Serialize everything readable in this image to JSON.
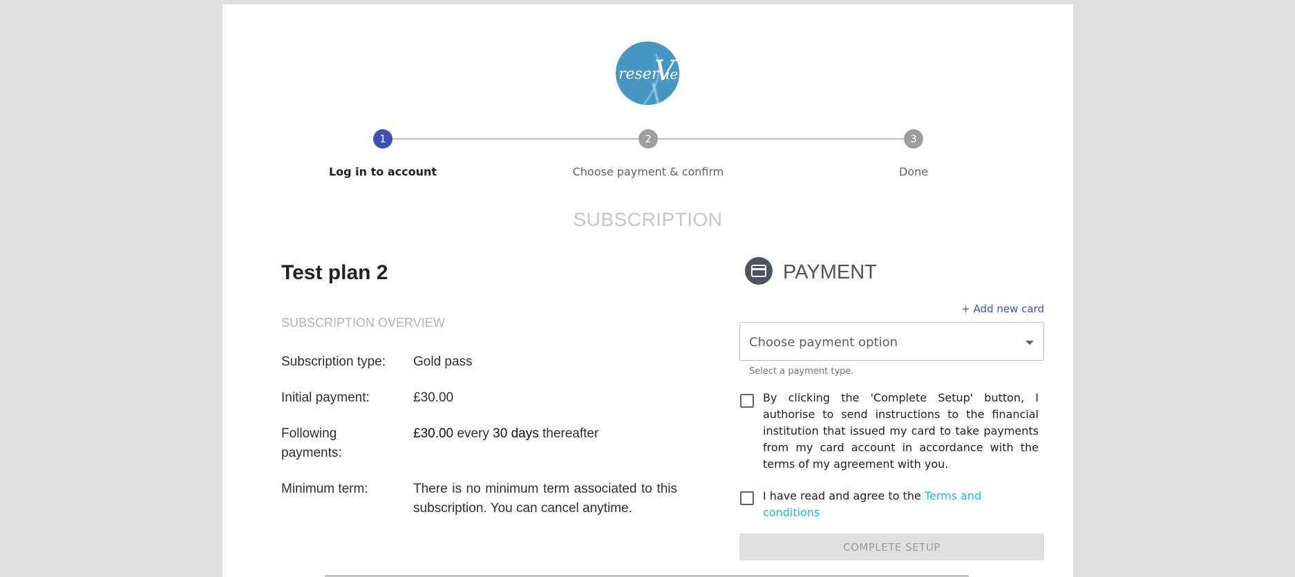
{
  "logo": {
    "text": "reserVie",
    "color": "#4797c2"
  },
  "stepper": {
    "steps": [
      {
        "number": "1",
        "label": "Log in to account",
        "active": true
      },
      {
        "number": "2",
        "label": "Choose payment & confirm",
        "active": false
      },
      {
        "number": "3",
        "label": "Done",
        "active": false
      }
    ],
    "active_color": "#3f51b5",
    "inactive_color": "#9e9e9e"
  },
  "section_title": "SUBSCRIPTION",
  "plan": {
    "name": "Test plan 2",
    "overview_heading": "SUBSCRIPTION OVERVIEW",
    "subscription_type_label": "Subscription type:",
    "subscription_type_value": "Gold pass",
    "initial_payment_label": "Initial payment:",
    "initial_payment_value": "£30.00",
    "following_payments_label": "Following payments:",
    "following_amount": "£30.00",
    "following_every": "every",
    "following_period": "30 days",
    "following_thereafter": "thereafter",
    "minimum_term_label": "Minimum term:",
    "minimum_term_value": "There is no minimum term associated to this subscription. You can cancel anytime."
  },
  "payment": {
    "icon": "credit-card-icon",
    "title": "PAYMENT",
    "add_card_label": "+ Add new card",
    "select_placeholder": "Choose payment option",
    "select_helper": "Select a payment type.",
    "authorise_text": "By clicking the 'Complete Setup' button, I authorise to send instructions to the financial institution that issued my card to take payments from my card account in accordance with the terms of my agreement with you.",
    "terms_prefix": "I have read and agree to the",
    "terms_link": "Terms and conditions",
    "complete_button": "COMPLETE SETUP",
    "link_color": "#26b6d8"
  }
}
